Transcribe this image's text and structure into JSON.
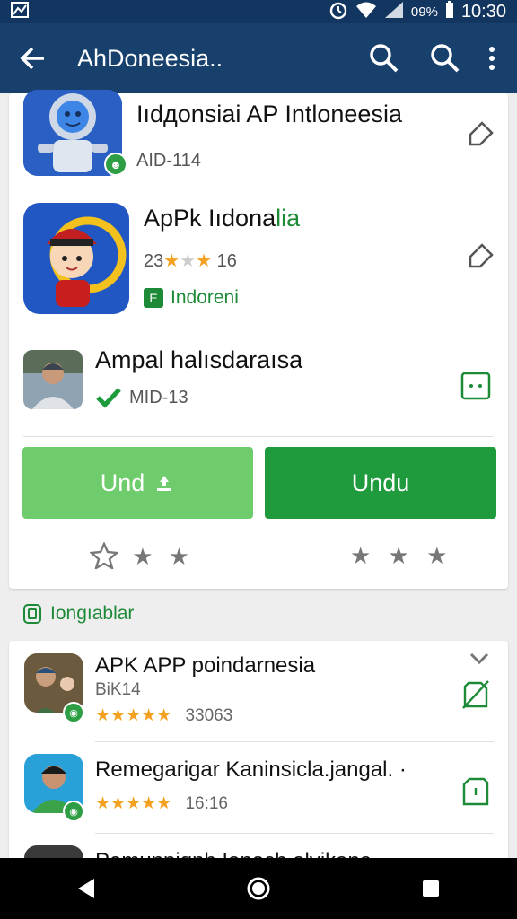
{
  "status_bar": {
    "battery": "09%",
    "time": "10:30"
  },
  "app_bar": {
    "title": "AhDoneesia.."
  },
  "apps": [
    {
      "title": "Iıdдonsiai AP Intloneesia",
      "sub": "AID-114"
    },
    {
      "title_part1": "ApPk Iıdona",
      "title_part2": "lia",
      "rating_left": "23",
      "rating_right": "16",
      "tag": "Indoreni"
    },
    {
      "title": "Ampal halısdaraısa",
      "sub": "MID-13"
    }
  ],
  "buttons": {
    "left_label": "Und",
    "right_label": "Undu"
  },
  "section": {
    "label": "Iongıablar"
  },
  "list": [
    {
      "title": "APK APP poindarnesia",
      "sub": "BiK14",
      "count": "33063"
    },
    {
      "title": "Remegarigar Kaninsicla.jangal. ·",
      "count": "16:16"
    },
    {
      "title": "Pemunpiqnh Ianoch elyikana"
    }
  ],
  "colors": {
    "app_bar": "#17406c",
    "status_bar": "#12365f",
    "primary_green": "#1f9a3c",
    "light_green": "#6fcc6c",
    "star": "#f4a020"
  }
}
